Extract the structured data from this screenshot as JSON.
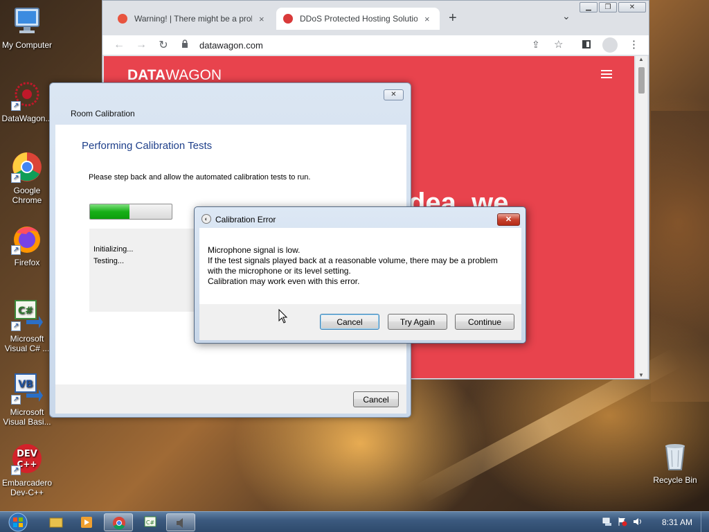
{
  "desktop": {
    "icons": [
      {
        "label": "My Computer",
        "icon": "computer-icon"
      },
      {
        "label": "DataWagon...",
        "icon": "datawagon-icon"
      },
      {
        "label": "Google Chrome",
        "icon": "chrome-icon"
      },
      {
        "label": "Firefox",
        "icon": "firefox-icon"
      },
      {
        "label": "Microsoft Visual C# ...",
        "icon": "visual-csharp-icon"
      },
      {
        "label": "Microsoft Visual Basi...",
        "icon": "visual-basic-icon"
      },
      {
        "label": "Embarcadero Dev-C++",
        "icon": "devcpp-icon"
      },
      {
        "label": "Recycle Bin",
        "icon": "recycle-bin-icon"
      }
    ]
  },
  "browser": {
    "tabs": [
      {
        "title": "Warning! | There might be a prob",
        "close": "×",
        "favicon_color": "#e8543f"
      },
      {
        "title": "DDoS Protected Hosting Solution",
        "close": "×",
        "favicon_color": "#d93a3a"
      }
    ],
    "new_tab": "+",
    "tab_menu": "⌄",
    "url": "datawagon.com",
    "page": {
      "logo_bold": "DATA",
      "logo_light": "WAGON",
      "background": "#e8434d",
      "partial_text": "dea, we"
    }
  },
  "room_calibration": {
    "window_title": "Room Calibration",
    "close": "✕",
    "heading": "Performing Calibration Tests",
    "description": "Please step back and allow the automated calibration tests to run.",
    "progress_fraction": 0.48,
    "log_lines": [
      "Initializing...",
      "Testing..."
    ],
    "cancel_label": "Cancel"
  },
  "calibration_error": {
    "title": "Calibration Error",
    "close": "✕",
    "message_lines": [
      "Microphone signal is low.",
      "If the test signals played back at a reasonable volume, there may be a problem",
      "with the microphone or its level setting.",
      "Calibration may work even with this error."
    ],
    "buttons": {
      "cancel": "Cancel",
      "try_again": "Try Again",
      "continue": "Continue"
    }
  },
  "taskbar": {
    "clock": "8:31 AM"
  }
}
